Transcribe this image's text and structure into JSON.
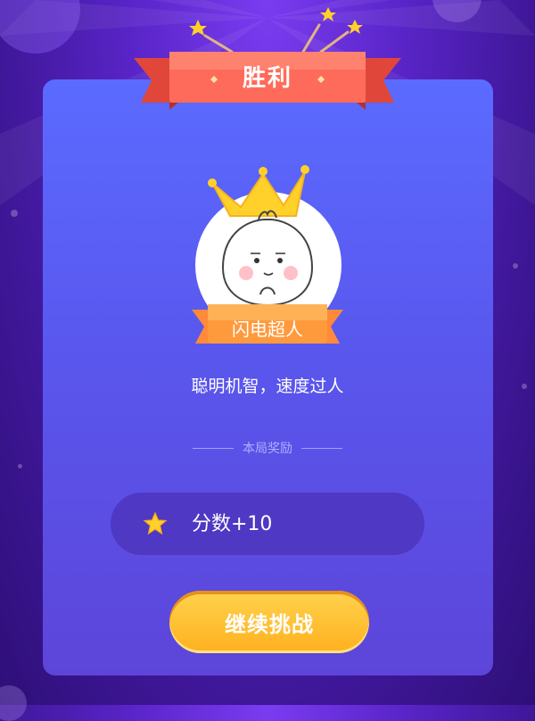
{
  "result": {
    "title": "胜利"
  },
  "badge": {
    "name": "闪电超人",
    "description": "聪明机智，速度过人"
  },
  "rewards": {
    "heading": "本局奖励",
    "items": [
      {
        "icon": "star-icon",
        "text": "分数+10"
      }
    ]
  },
  "actions": {
    "continue_label": "继续挑战"
  },
  "colors": {
    "ribbon": "#ff6b5a",
    "card": "#5b6bff",
    "button": "#ffc234",
    "star": "#ffd12a"
  }
}
